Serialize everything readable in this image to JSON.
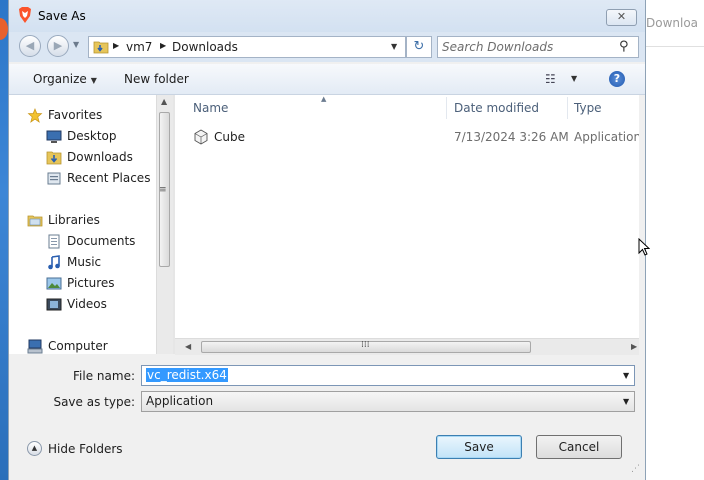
{
  "background": {
    "partial_tab_text": "Downloa"
  },
  "dialog": {
    "title": "Save As",
    "close_glyph": "✕"
  },
  "address_bar": {
    "breadcrumb": [
      "vm7",
      "Downloads"
    ],
    "search_placeholder": "Search Downloads"
  },
  "toolbar": {
    "organize_label": "Organize",
    "new_folder_label": "New folder",
    "help_glyph": "?"
  },
  "nav_pane": {
    "favorites_label": "Favorites",
    "favorites": [
      "Desktop",
      "Downloads",
      "Recent Places"
    ],
    "libraries_label": "Libraries",
    "libraries": [
      "Documents",
      "Music",
      "Pictures",
      "Videos"
    ],
    "computer_label": "Computer"
  },
  "file_list": {
    "columns": [
      "Name",
      "Date modified",
      "Type"
    ],
    "rows": [
      {
        "name": "Cube",
        "date_modified": "7/13/2024 3:26 AM",
        "type": "Application"
      }
    ]
  },
  "fields": {
    "file_name_label": "File name:",
    "file_name_value": "vc_redist.x64",
    "save_type_label": "Save as type:",
    "save_type_value": "Application"
  },
  "footer": {
    "hide_folders_label": "Hide Folders",
    "save_label": "Save",
    "cancel_label": "Cancel"
  }
}
